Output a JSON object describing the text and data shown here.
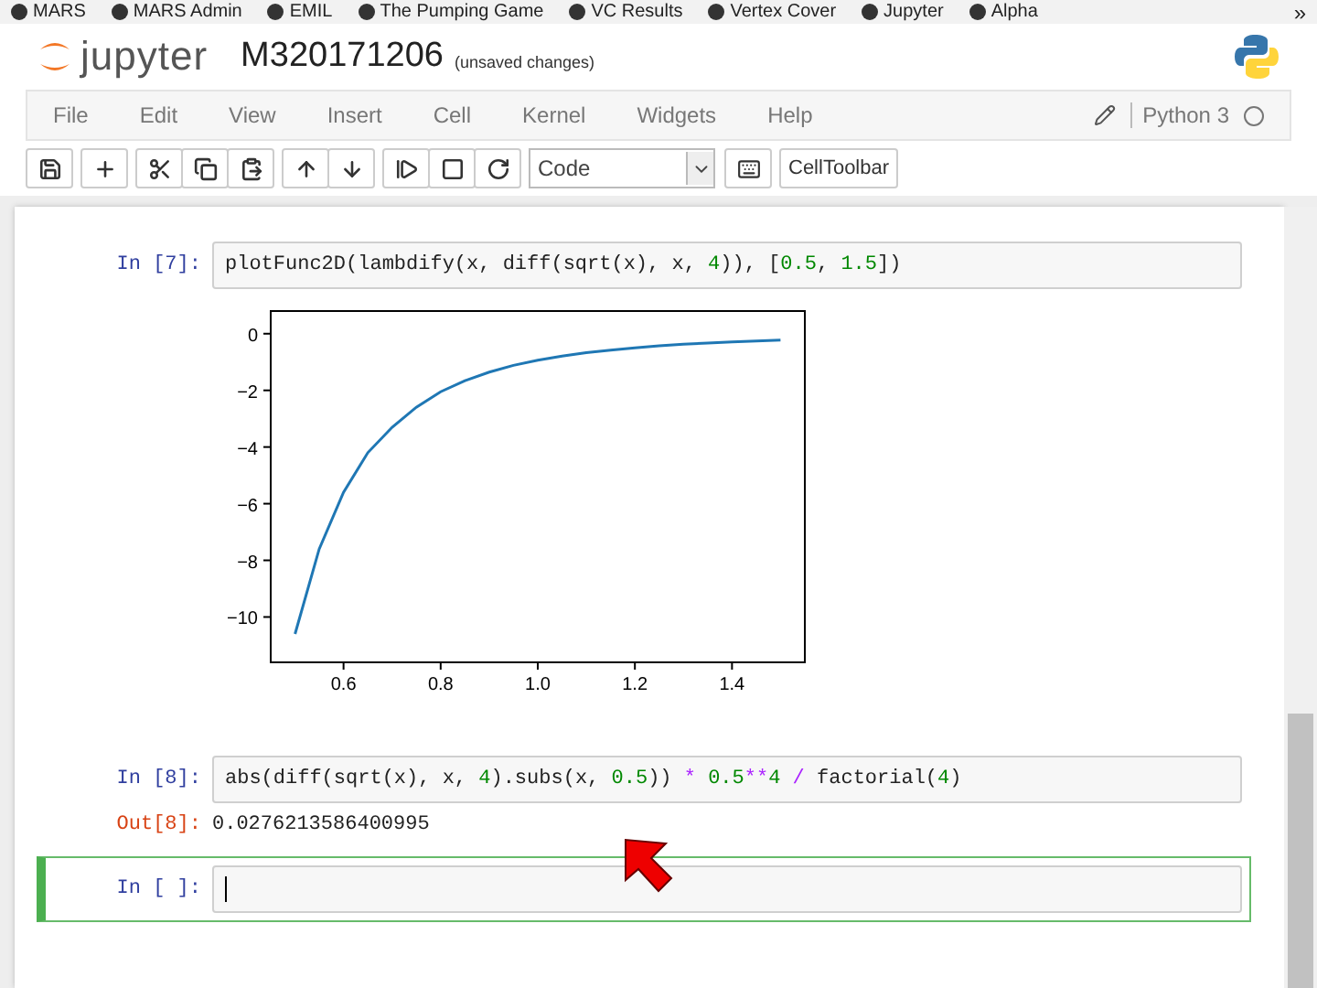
{
  "bookmarks": [
    {
      "label": "MARS"
    },
    {
      "label": "MARS Admin"
    },
    {
      "label": "EMIL"
    },
    {
      "label": "The Pumping Game"
    },
    {
      "label": "VC Results"
    },
    {
      "label": "Vertex Cover"
    },
    {
      "label": "Jupyter"
    },
    {
      "label": "Alpha"
    }
  ],
  "bookmarks_more": "»",
  "header": {
    "logo_text": "jupyter",
    "notebook_name": "M320171206",
    "save_status": "(unsaved changes)"
  },
  "menu": [
    "File",
    "Edit",
    "View",
    "Insert",
    "Cell",
    "Kernel",
    "Widgets",
    "Help"
  ],
  "kernel": {
    "name": "Python 3",
    "busy": false
  },
  "toolbar": {
    "cell_type": "Code",
    "cell_toolbar": "CellToolbar"
  },
  "cells": [
    {
      "prompt": "In [7]:",
      "selected": false,
      "code": [
        {
          "text": "plotFunc2D(lambdify(x, diff(sqrt(x), x, ",
          "kind": "plain"
        },
        {
          "text": "4",
          "kind": "number"
        },
        {
          "text": ")), [",
          "kind": "plain"
        },
        {
          "text": "0.5",
          "kind": "number"
        },
        {
          "text": ", ",
          "kind": "plain"
        },
        {
          "text": "1.5",
          "kind": "number"
        },
        {
          "text": "])",
          "kind": "plain"
        }
      ],
      "output": {
        "kind": "plot",
        "chart_data": {
          "type": "line",
          "x": [
            0.5,
            0.55,
            0.6,
            0.65,
            0.7,
            0.75,
            0.8,
            0.85,
            0.9,
            0.95,
            1.0,
            1.05,
            1.1,
            1.15,
            1.2,
            1.25,
            1.3,
            1.35,
            1.4,
            1.45,
            1.5
          ],
          "series": [
            {
              "color": "#1f77b4",
              "values": [
                -10.6,
                -7.6,
                -5.6,
                -4.2,
                -3.3,
                -2.6,
                -2.05,
                -1.66,
                -1.36,
                -1.12,
                -0.94,
                -0.79,
                -0.67,
                -0.58,
                -0.5,
                -0.43,
                -0.37,
                -0.33,
                -0.29,
                -0.26,
                -0.23
              ]
            }
          ],
          "xlim": [
            0.45,
            1.55
          ],
          "ylim": [
            -11.6,
            0.8
          ],
          "xticks": [
            {
              "value": 0.6,
              "label": "0.6"
            },
            {
              "value": 0.8,
              "label": "0.8"
            },
            {
              "value": 1.0,
              "label": "1.0"
            },
            {
              "value": 1.2,
              "label": "1.2"
            },
            {
              "value": 1.4,
              "label": "1.4"
            }
          ],
          "yticks": [
            {
              "value": 0,
              "label": "0"
            },
            {
              "value": -2,
              "label": "−2"
            },
            {
              "value": -4,
              "label": "−4"
            },
            {
              "value": -6,
              "label": "−6"
            },
            {
              "value": -8,
              "label": "−8"
            },
            {
              "value": -10,
              "label": "−10"
            }
          ]
        }
      }
    },
    {
      "prompt": "In [8]:",
      "selected": false,
      "code": [
        {
          "text": "abs(diff(sqrt(x), x, ",
          "kind": "plain"
        },
        {
          "text": "4",
          "kind": "number"
        },
        {
          "text": ").subs(x, ",
          "kind": "plain"
        },
        {
          "text": "0.5",
          "kind": "number"
        },
        {
          "text": ")) ",
          "kind": "plain"
        },
        {
          "text": "*",
          "kind": "operator"
        },
        {
          "text": " 0.5",
          "kind": "number"
        },
        {
          "text": "**",
          "kind": "operator"
        },
        {
          "text": "4",
          "kind": "number"
        },
        {
          "text": " / ",
          "kind": "operator"
        },
        {
          "text": "factorial(",
          "kind": "plain"
        },
        {
          "text": "4",
          "kind": "number"
        },
        {
          "text": ")",
          "kind": "plain"
        }
      ],
      "output": {
        "kind": "text",
        "prompt": "Out[8]:",
        "text": "0.0276213586400995"
      }
    },
    {
      "prompt": "In [ ]:",
      "selected": true
    }
  ]
}
